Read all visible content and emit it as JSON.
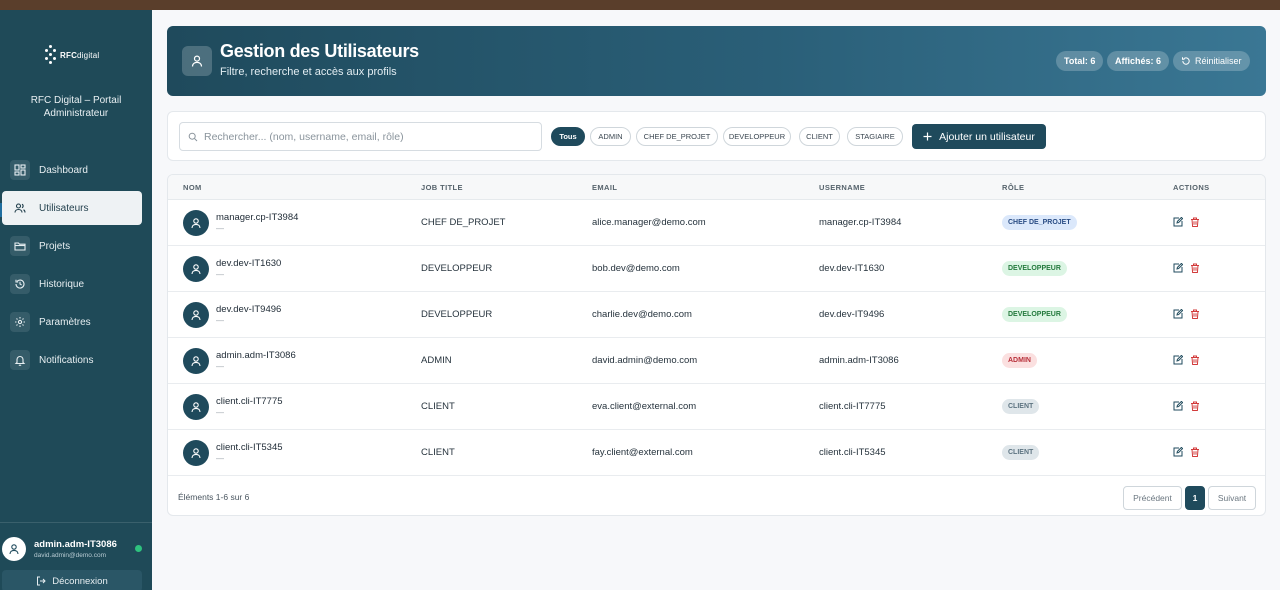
{
  "app": {
    "logo_text": "RFC",
    "logo_text_light": "digital",
    "portal_title": "RFC Digital – Portail Administrateur"
  },
  "sidebar": {
    "items": [
      {
        "label": "Dashboard",
        "icon": "dashboard-icon"
      },
      {
        "label": "Utilisateurs",
        "icon": "users-icon",
        "active": true
      },
      {
        "label": "Projets",
        "icon": "folder-icon"
      },
      {
        "label": "Historique",
        "icon": "history-icon"
      },
      {
        "label": "Paramètres",
        "icon": "gear-icon"
      },
      {
        "label": "Notifications",
        "icon": "bell-icon"
      }
    ],
    "user": {
      "name": "admin.adm-IT3086",
      "email": "david.admin@demo.com"
    },
    "logout_label": "Déconnexion"
  },
  "header": {
    "title": "Gestion des Utilisateurs",
    "subtitle": "Filtre, recherche et accès aux profils",
    "total_label": "Total: 6",
    "shown_label": "Affichés: 6",
    "reset_label": "Réinitialiser"
  },
  "filters": {
    "search_placeholder": "Rechercher... (nom, username, email, rôle)",
    "search_value": "",
    "chips": [
      "Tous",
      "ADMIN",
      "CHEF DE_PROJET",
      "DEVELOPPEUR",
      "CLIENT",
      "STAGIAIRE"
    ],
    "active_chip": "Tous",
    "add_label": "Ajouter un utilisateur"
  },
  "table": {
    "columns": [
      "NOM",
      "JOB TITLE",
      "EMAIL",
      "USERNAME",
      "RÔLE",
      "ACTIONS"
    ],
    "rows": [
      {
        "name": "manager.cp-IT3984",
        "sub": "—",
        "job": "CHEF DE_PROJET",
        "email": "alice.manager@demo.com",
        "username": "manager.cp-IT3984",
        "role": "CHEF DE_PROJET"
      },
      {
        "name": "dev.dev-IT1630",
        "sub": "—",
        "job": "DEVELOPPEUR",
        "email": "bob.dev@demo.com",
        "username": "dev.dev-IT1630",
        "role": "DEVELOPPEUR"
      },
      {
        "name": "dev.dev-IT9496",
        "sub": "—",
        "job": "DEVELOPPEUR",
        "email": "charlie.dev@demo.com",
        "username": "dev.dev-IT9496",
        "role": "DEVELOPPEUR"
      },
      {
        "name": "admin.adm-IT3086",
        "sub": "—",
        "job": "ADMIN",
        "email": "david.admin@demo.com",
        "username": "admin.adm-IT3086",
        "role": "ADMIN"
      },
      {
        "name": "client.cli-IT7775",
        "sub": "—",
        "job": "CLIENT",
        "email": "eva.client@external.com",
        "username": "client.cli-IT7775",
        "role": "CLIENT"
      },
      {
        "name": "client.cli-IT5345",
        "sub": "—",
        "job": "CLIENT",
        "email": "fay.client@external.com",
        "username": "client.cli-IT5345",
        "role": "CLIENT"
      }
    ],
    "footer_count": "Éléments 1-6 sur 6",
    "prev_label": "Précédent",
    "current_page": "1",
    "next_label": "Suivant"
  },
  "colors": {
    "sidebar_bg": "#1f4a58",
    "primary": "#1f4a5c",
    "online": "#2ec27e",
    "edit_icon": "#1f4a5c",
    "delete_icon": "#d23a3a"
  }
}
